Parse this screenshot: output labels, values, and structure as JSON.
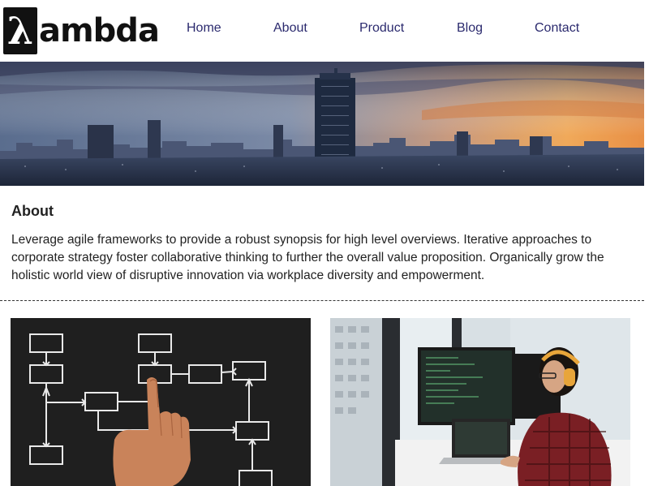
{
  "brand": {
    "logo_symbol": "λ",
    "logo_text": "ambda"
  },
  "nav": {
    "items": [
      {
        "label": "Home"
      },
      {
        "label": "About"
      },
      {
        "label": "Product"
      },
      {
        "label": "Blog"
      },
      {
        "label": "Contact"
      }
    ]
  },
  "about": {
    "title": "About",
    "body": "Leverage agile frameworks to provide a robust synopsis for high level overviews. Iterative approaches to corporate strategy foster collaborative thinking to further the overall value proposition. Organically grow the holistic world view of disruptive innovation via workplace diversity and empowerment."
  },
  "colors": {
    "nav_link": "#2b2a6e",
    "logo": "#111111"
  },
  "images": {
    "hero": "city-skyline-sunset",
    "left": "hand-pointing-flowchart-chalkboard",
    "right": "developer-with-headphones-at-monitors"
  }
}
